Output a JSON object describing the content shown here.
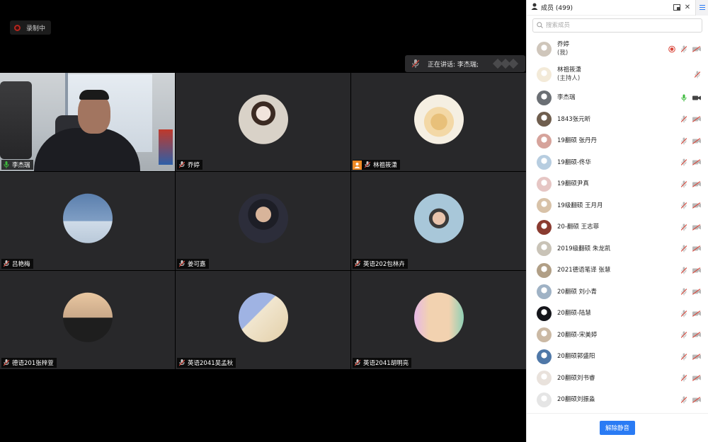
{
  "recording": {
    "label": "录制中"
  },
  "speaker_banner": {
    "text": "正在讲话: 李杰瑞;"
  },
  "tiles": [
    {
      "name": "李杰瑞",
      "mic": "on",
      "kind": "video"
    },
    {
      "name": "乔婷",
      "mic": "muted",
      "kind": "avatar",
      "avatar_color": "#d9d2c8"
    },
    {
      "name": "林祖筱潇",
      "mic": "muted",
      "kind": "avatar",
      "host": true,
      "avatar_color": "#f5efe2"
    },
    {
      "name": "吕艳梅",
      "mic": "muted",
      "kind": "avatar",
      "avatar_color": "#7f9ec4"
    },
    {
      "name": "姜可嘉",
      "mic": "muted",
      "kind": "avatar",
      "avatar_color": "#2c2d3a"
    },
    {
      "name": "英语202包林卉",
      "mic": "muted",
      "kind": "avatar",
      "avatar_color": "#a8c7d9"
    },
    {
      "name": "德语201张梓萱",
      "mic": "muted",
      "kind": "avatar",
      "avatar_color": "#c9a889"
    },
    {
      "name": "英语2041吴孟秋",
      "mic": "muted",
      "kind": "avatar",
      "avatar_color": "#9fb3e3"
    },
    {
      "name": "英语2041胡明亮",
      "mic": "muted",
      "kind": "avatar",
      "avatar_color": "#cfe3c6"
    }
  ],
  "sidebar": {
    "title": "成员 (499)",
    "search_placeholder": "搜索成员",
    "unmute_label": "解除静音",
    "members": [
      {
        "name": "乔婷",
        "sub": "(我)",
        "color": "#cfc6bb",
        "recording": true,
        "mic": "muted",
        "cam": "off"
      },
      {
        "name": "林祖筱潇",
        "sub": "(主持人)",
        "color": "#f3ead8",
        "mic": "muted"
      },
      {
        "name": "李杰瑞",
        "color": "#6b6f74",
        "mic": "on",
        "cam": "on"
      },
      {
        "name": "1843张元昕",
        "color": "#6f5e4e",
        "mic": "muted",
        "cam": "off"
      },
      {
        "name": "19翻硕 张丹丹",
        "color": "#d6a39b",
        "mic": "muted",
        "cam": "off"
      },
      {
        "name": "19翻硕-佟华",
        "color": "#b7cde0",
        "mic": "muted",
        "cam": "off"
      },
      {
        "name": "19翻硕尹真",
        "color": "#e6c6c4",
        "mic": "muted",
        "cam": "off"
      },
      {
        "name": "19级翻硕 王月月",
        "color": "#d8c2a8",
        "mic": "muted",
        "cam": "off"
      },
      {
        "name": "20-翻硕 王志菲",
        "color": "#8a3b30",
        "mic": "muted",
        "cam": "off"
      },
      {
        "name": "2019级翻硕 朱龙凯",
        "color": "#c9c3b7",
        "mic": "muted",
        "cam": "off"
      },
      {
        "name": "2021德语笔译 张慧",
        "color": "#b19f86",
        "mic": "muted",
        "cam": "off"
      },
      {
        "name": "20翻硕 刘小青",
        "color": "#9fb2c5",
        "mic": "muted",
        "cam": "off"
      },
      {
        "name": "20翻硕-陆慧",
        "color": "#14151a",
        "mic": "muted",
        "cam": "off"
      },
      {
        "name": "20翻硕-宋美婷",
        "color": "#cbb9a4",
        "mic": "muted",
        "cam": "off"
      },
      {
        "name": "20翻硕郭盛阳",
        "color": "#4f78a8",
        "mic": "muted",
        "cam": "off"
      },
      {
        "name": "20翻硕刘书睿",
        "color": "#e9e2dc",
        "mic": "muted",
        "cam": "off"
      },
      {
        "name": "20翻硕刘振淼",
        "color": "#e5e5e5",
        "mic": "muted",
        "cam": "off"
      },
      {
        "name": "",
        "color": "#d8cfc4",
        "mic": "muted",
        "cam": "off"
      }
    ]
  },
  "colors": {
    "active_border": "#4fbd5a",
    "mic_on": "#3cba3c",
    "muted_red": "#d9463a",
    "accent": "#2a7bf4",
    "host_badge": "#f08a24"
  }
}
